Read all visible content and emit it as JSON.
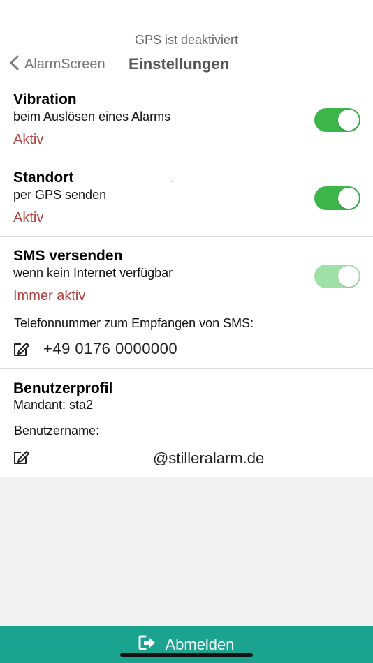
{
  "header": {
    "gps_status": "GPS ist deaktiviert",
    "back_label": "AlarmScreen",
    "title": "Einstellungen"
  },
  "vibration": {
    "title": "Vibration",
    "subtitle": "beim Auslösen eines Alarms",
    "status": "Aktiv",
    "enabled": true
  },
  "standort": {
    "title": "Standort",
    "subtitle": "per GPS senden",
    "status": "Aktiv",
    "enabled": true
  },
  "sms": {
    "title": "SMS versenden",
    "subtitle": "wenn kein Internet verfügbar",
    "status": "Immer aktiv",
    "enabled": true,
    "phone_label": "Telefonnummer zum Empfangen von SMS:",
    "phone_value": "+49 0176 0000000"
  },
  "profile": {
    "title": "Benutzerprofil",
    "mandant": "Mandant: sta2",
    "username_label": "Benutzername:",
    "username_value": "@stilleralarm.de"
  },
  "footer": {
    "logout_label": "Abmelden"
  },
  "colors": {
    "accent_green": "#3cb54a",
    "status_red": "#b0413e",
    "footer_teal": "#1aa38f"
  },
  "icons": {
    "back": "chevron-left-icon",
    "edit": "edit-icon",
    "logout": "sign-out-icon"
  }
}
